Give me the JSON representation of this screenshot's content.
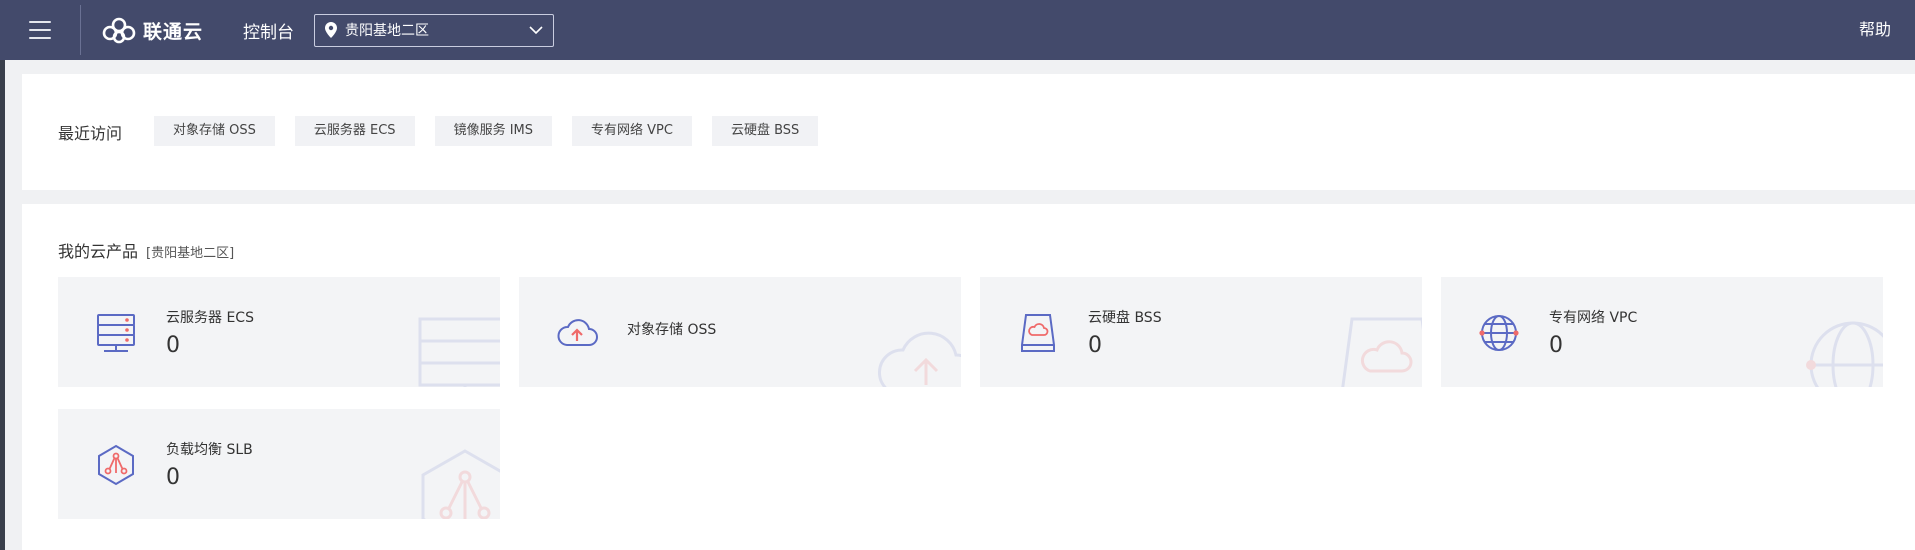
{
  "header": {
    "brand": "联通云",
    "console": "控制台",
    "region": "贵阳基地二区",
    "help": "帮助"
  },
  "recent": {
    "label": "最近访问",
    "items": [
      {
        "label": "对象存储 OSS"
      },
      {
        "label": "云服务器 ECS"
      },
      {
        "label": "镜像服务 IMS"
      },
      {
        "label": "专有网络 VPC"
      },
      {
        "label": "云硬盘 BSS"
      }
    ]
  },
  "products": {
    "title": "我的云产品",
    "region": "[贵阳基地二区]",
    "cards": [
      {
        "name": "云服务器 ECS",
        "count": "0",
        "icon": "server-icon"
      },
      {
        "name": "对象存储 OSS",
        "count": "",
        "icon": "cloud-upload-icon"
      },
      {
        "name": "云硬盘 BSS",
        "count": "0",
        "icon": "disk-icon"
      },
      {
        "name": "专有网络 VPC",
        "count": "0",
        "icon": "globe-icon"
      },
      {
        "name": "负载均衡 SLB",
        "count": "0",
        "icon": "load-balancer-icon"
      }
    ]
  },
  "colors": {
    "header_bg": "#434a6b",
    "icon_blue": "#5b6ac4",
    "icon_red": "#ef6a6a",
    "card_bg": "#f3f4f6"
  }
}
